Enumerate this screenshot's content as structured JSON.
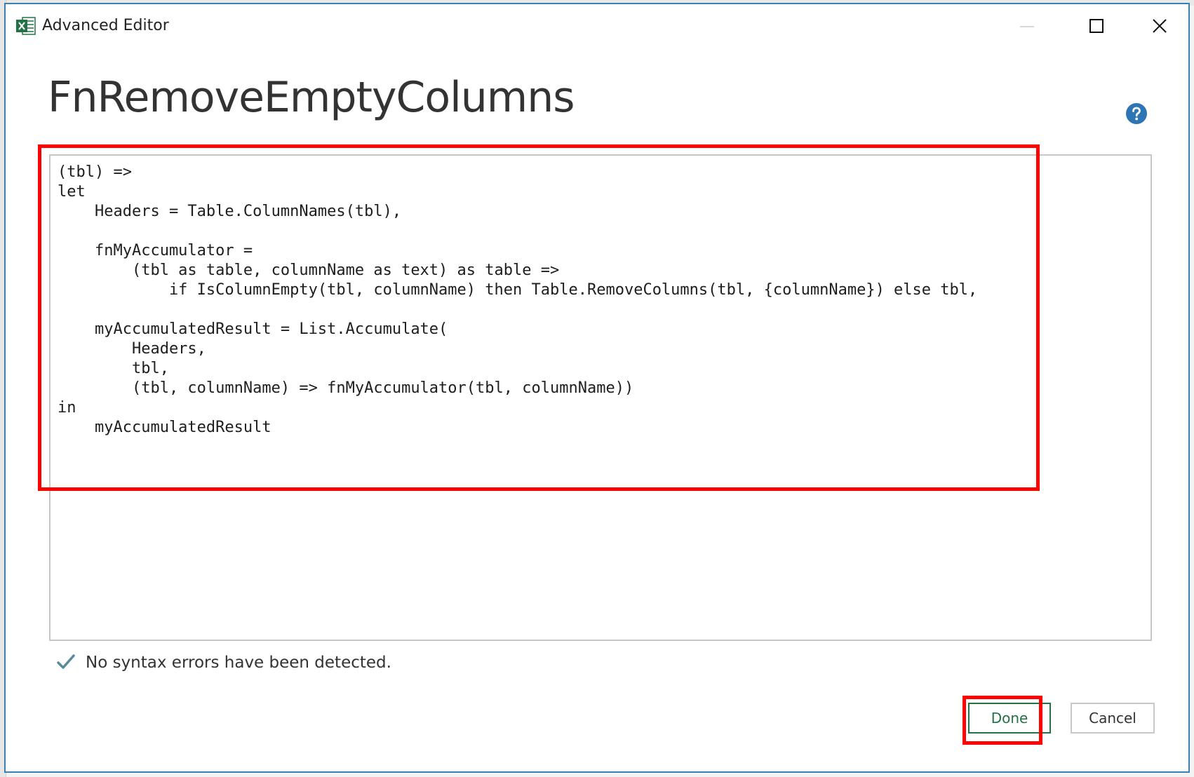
{
  "window": {
    "title": "Advanced Editor",
    "app_icon": "excel-icon",
    "controls": [
      "minimize-icon",
      "maximize-icon",
      "close-icon"
    ]
  },
  "query": {
    "name": "FnRemoveEmptyColumns"
  },
  "editor": {
    "code_lines": [
      "(tbl) =>",
      "let",
      "    Headers = Table.ColumnNames(tbl),",
      "",
      "    fnMyAccumulator =",
      "        (tbl as table, columnName as text) as table =>",
      "            if IsColumnEmpty(tbl, columnName) then Table.RemoveColumns(tbl, {columnName}) else tbl,",
      "",
      "    myAccumulatedResult = List.Accumulate(",
      "        Headers,",
      "        tbl,",
      "        (tbl, columnName) => fnMyAccumulator(tbl, columnName))",
      "in",
      "    myAccumulatedResult"
    ]
  },
  "status": {
    "message": "No syntax errors have been detected.",
    "icon": "check-icon"
  },
  "buttons": {
    "done_label": "Done",
    "cancel_label": "Cancel"
  },
  "colors": {
    "excel_green": "#217346",
    "help_blue": "#2e75b6",
    "annotation_red": "#ff0000",
    "window_border": "#3c7fb1"
  }
}
